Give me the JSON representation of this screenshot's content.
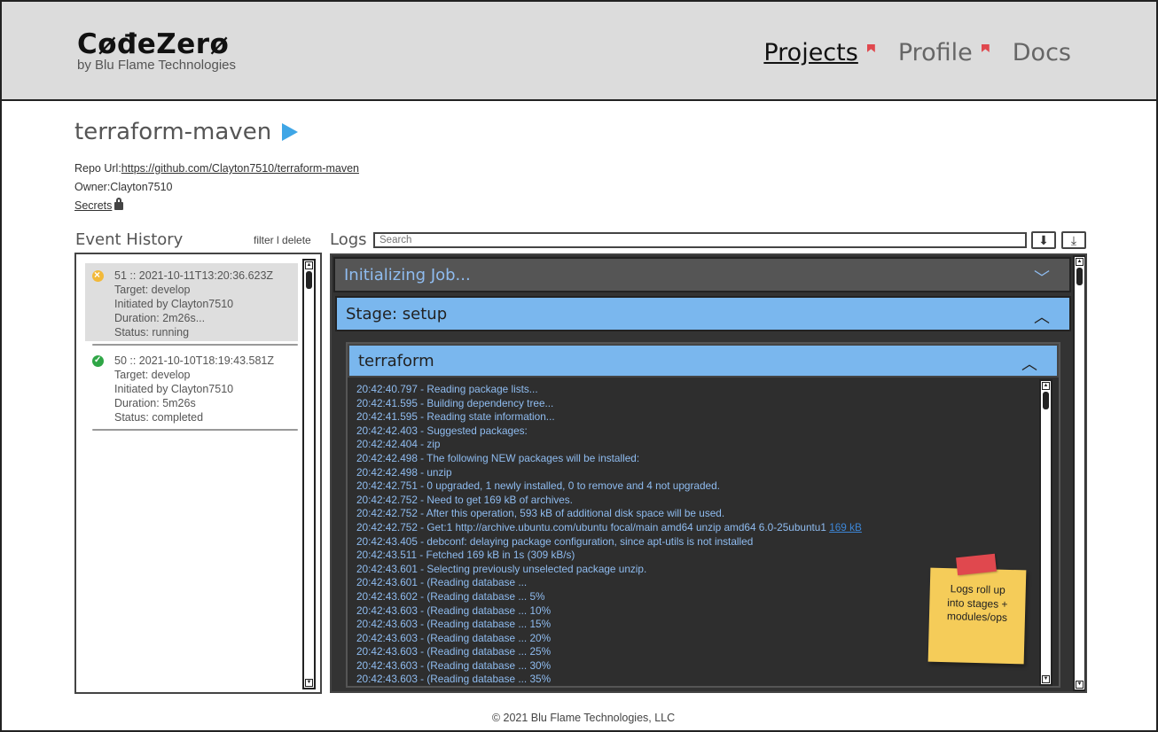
{
  "header": {
    "logo_main": "CøđeZerø",
    "logo_sub": "by Blu Flame Technologies",
    "nav": [
      "Projects",
      "Profile",
      "Docs"
    ]
  },
  "project": {
    "name": "terraform-maven",
    "repo_label": "Repo Url:",
    "repo_url": "https://github.com/Clayton7510/terraform-maven",
    "owner_label": "Owner:",
    "owner": "Clayton7510",
    "secrets": "Secrets"
  },
  "event_history": {
    "title": "Event History",
    "filter": "filter",
    "sep": "l",
    "delete": "delete",
    "events": [
      {
        "header": "51 :: 2021-10-11T13:20:36.623Z",
        "target": "Target: develop",
        "initiated": "Initiated by Clayton7510",
        "duration": "Duration: 2m26s...",
        "status": "Status: running"
      },
      {
        "header": "50 :: 2021-10-10T18:19:43.581Z",
        "target": "Target: develop",
        "initiated": "Initiated by Clayton7510",
        "duration": "Duration: 5m26s",
        "status": "Status: completed"
      }
    ]
  },
  "logs": {
    "title": "Logs",
    "search_placeholder": "Search",
    "init_job": "Initializing Job...",
    "stage": "Stage: setup",
    "module": "terraform",
    "lines": [
      "20:42:40.797 - Reading package lists...",
      "20:42:41.595 - Building dependency tree...",
      "20:42:41.595 - Reading state information...",
      "20:42:42.403 - Suggested packages:",
      "20:42:42.404 - zip",
      "20:42:42.498 - The following NEW packages will be installed:",
      "20:42:42.498 - unzip",
      "20:42:42.751 - 0 upgraded, 1 newly installed, 0 to remove and 4 not upgraded.",
      "20:42:42.752 - Need to get 169 kB of archives.",
      "20:42:42.752 - After this operation, 593 kB of additional disk space will be used.",
      "20:42:42.752 - Get:1 http://archive.ubuntu.com/ubuntu focal/main amd64 unzip amd64 6.0-25ubuntu1",
      "20:42:43.405 - debconf: delaying package configuration, since apt-utils is not installed",
      "20:42:43.511 - Fetched 169 kB in 1s (309 kB/s)",
      "20:42:43.601 - Selecting previously unselected package unzip.",
      "20:42:43.601 - (Reading database ...",
      "20:42:43.602 - (Reading database ... 5%",
      "20:42:43.603 - (Reading database ... 10%",
      "20:42:43.603 - (Reading database ... 15%",
      "20:42:43.603 - (Reading database ... 20%",
      "20:42:43.603 - (Reading database ... 25%",
      "20:42:43.603 - (Reading database ... 30%",
      "20:42:43.603 - (Reading database ... 35%"
    ],
    "line_link": "169 kB"
  },
  "sticky_note": [
    "Logs roll up",
    "into stages +",
    "modules/ops"
  ],
  "footer": "© 2021 Blu Flame Technologies, LLC"
}
